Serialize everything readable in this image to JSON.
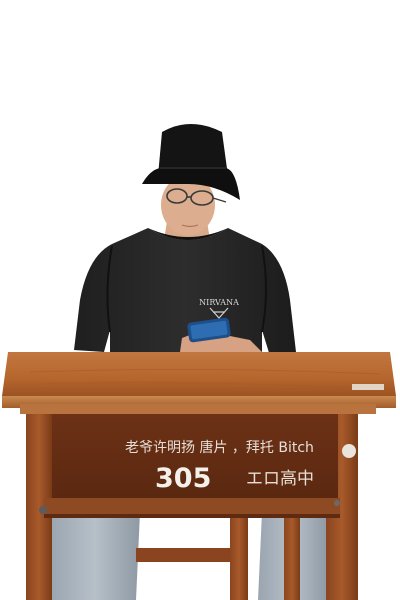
{
  "scene": {
    "subject": "person",
    "props": [
      "bucket-hat",
      "glasses",
      "phone",
      "school-desk",
      "chair"
    ],
    "colors": {
      "background": "#ffffff",
      "shirt": "#262626",
      "hat": "#141414",
      "desk_top": "#b5662d",
      "desk_wood": "#7a3b17",
      "jeans": "#a9b3bd",
      "chalk": "#f2efe8"
    }
  },
  "shirt": {
    "logo_text": "NIRVANA"
  },
  "desk": {
    "graffiti_line1": "老爷许明扬 唐片 ，拜托 Bitch",
    "class_number": "305",
    "school_name": "エロ高中"
  }
}
